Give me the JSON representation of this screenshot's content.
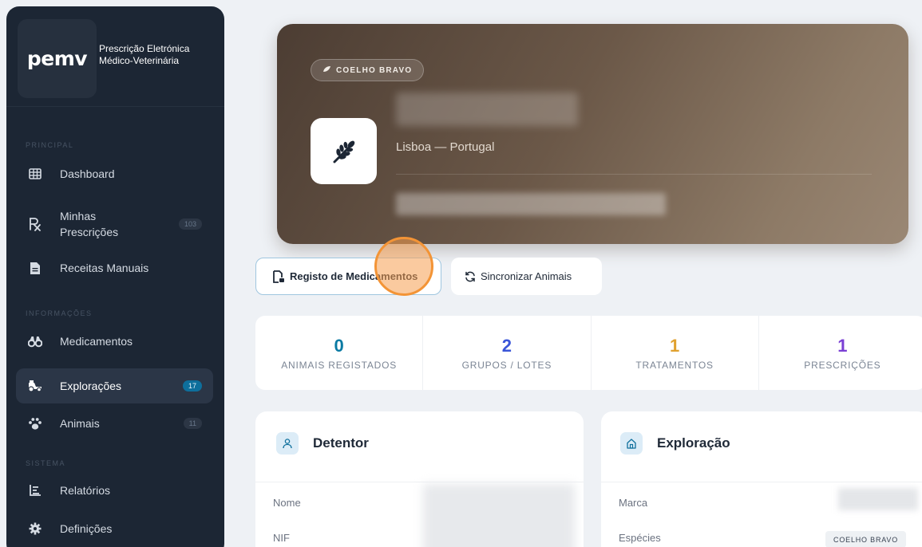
{
  "sidebar": {
    "logo": "pemv",
    "brand_line1": "Prescrição Eletrónica",
    "brand_line2": "Médico-Veterinária",
    "sections": {
      "principal": "PRINCIPAL",
      "informacoes": "INFORMAÇÕES",
      "sistema": "SISTEMA"
    },
    "items": [
      {
        "label": "Dashboard",
        "icon": "grid-icon"
      },
      {
        "label": "Minhas",
        "label2": "Prescrições",
        "icon": "rx-icon",
        "badge": "103"
      },
      {
        "label": "Receitas Manuais",
        "icon": "document-icon"
      },
      {
        "label": "Medicamentos",
        "icon": "binoculars-icon"
      },
      {
        "label": "Explorações",
        "icon": "tractor-icon",
        "badge": "17",
        "active": true
      },
      {
        "label": "Animais",
        "icon": "paw-icon",
        "badge": "11"
      },
      {
        "label": "Relatórios",
        "icon": "report-icon"
      },
      {
        "label": "Definições",
        "icon": "gear-icon"
      }
    ]
  },
  "hero": {
    "tag": "COELHO BRAVO",
    "location": "Lisboa — Portugal",
    "icon": "wheat-icon"
  },
  "actions": {
    "primary_label": "Registo de Medicamentos",
    "secondary_label": "Sincronizar Animais"
  },
  "stats": [
    {
      "value": "0",
      "label": "ANIMAIS REGISTADOS",
      "color": "#0a7aa3"
    },
    {
      "value": "2",
      "label": "GRUPOS / LOTES",
      "color": "#3a55d8"
    },
    {
      "value": "1",
      "label": "TRATAMENTOS",
      "color": "#e0a12f"
    },
    {
      "value": "1",
      "label": "PRESCRIÇÕES",
      "color": "#7a3fd4"
    }
  ],
  "detentor": {
    "title": "Detentor",
    "rows": [
      {
        "label": "Nome"
      },
      {
        "label": "NIF"
      }
    ]
  },
  "exploracao": {
    "title": "Exploração",
    "rows": [
      {
        "label": "Marca"
      },
      {
        "label": "Espécies"
      }
    ],
    "species_tag": "COELHO BRAVO"
  }
}
